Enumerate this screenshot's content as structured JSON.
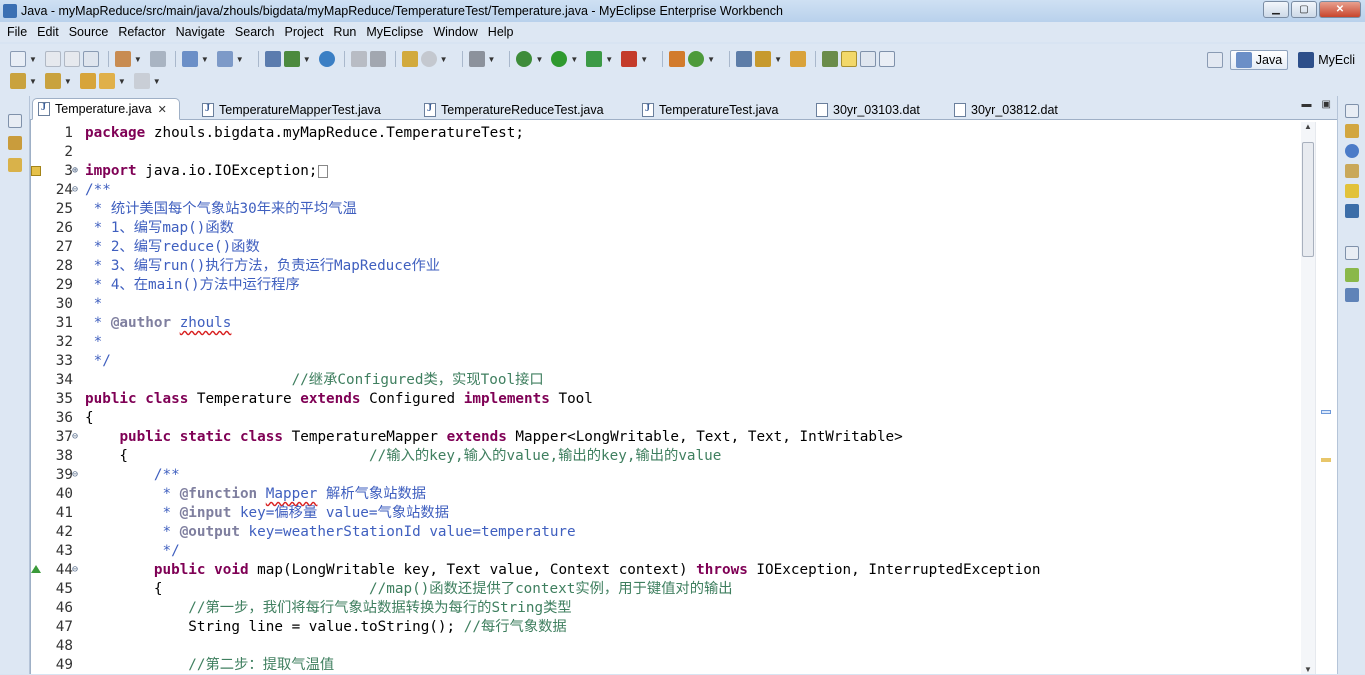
{
  "window": {
    "title": "Java - myMapReduce/src/main/java/zhouls/bigdata/myMapReduce/TemperatureTest/Temperature.java - MyEclipse Enterprise Workbench",
    "minimize": "▁",
    "maximize": "▢",
    "close": "✕"
  },
  "menu": [
    "File",
    "Edit",
    "Source",
    "Refactor",
    "Navigate",
    "Search",
    "Project",
    "Run",
    "MyEclipse",
    "Window",
    "Help"
  ],
  "perspectives": {
    "java": "Java",
    "myeclipse": "MyEcli"
  },
  "tabs": [
    {
      "label": "Temperature.java",
      "active": true,
      "type": "java"
    },
    {
      "label": "TemperatureMapperTest.java",
      "active": false,
      "type": "java"
    },
    {
      "label": "TemperatureReduceTest.java",
      "active": false,
      "type": "java"
    },
    {
      "label": "TemperatureTest.java",
      "active": false,
      "type": "java"
    },
    {
      "label": "30yr_03103.dat",
      "active": false,
      "type": "file"
    },
    {
      "label": "30yr_03812.dat",
      "active": false,
      "type": "file"
    }
  ],
  "tab_close": "✕",
  "colors": {
    "keyword": "#7f0055",
    "javadoc": "#3f5fbf",
    "line_comment": "#3f7f5f",
    "javadoc_tag": "#7f7f9f"
  },
  "code_lines": [
    {
      "n": "1",
      "fold": "",
      "parts": [
        {
          "t": "package",
          "c": "kw"
        },
        {
          "t": " zhouls.bigdata.myMapReduce.TemperatureTest;",
          "c": ""
        }
      ]
    },
    {
      "n": "2",
      "fold": "",
      "parts": []
    },
    {
      "n": "3",
      "fold": "⊕",
      "mark": "warn",
      "parts": [
        {
          "t": "import",
          "c": "kw"
        },
        {
          "t": " java.io.IOException;",
          "c": ""
        },
        {
          "t": "",
          "c": "fbox"
        }
      ]
    },
    {
      "n": "24",
      "fold": "⊖",
      "parts": [
        {
          "t": "/**",
          "c": "cm"
        }
      ]
    },
    {
      "n": "25",
      "fold": "",
      "parts": [
        {
          "t": " * 统计美国每个气象站30年来的平均气温",
          "c": "cm"
        }
      ]
    },
    {
      "n": "26",
      "fold": "",
      "parts": [
        {
          "t": " * 1、编写map()函数",
          "c": "cm"
        }
      ]
    },
    {
      "n": "27",
      "fold": "",
      "parts": [
        {
          "t": " * 2、编写reduce()函数",
          "c": "cm"
        }
      ]
    },
    {
      "n": "28",
      "fold": "",
      "parts": [
        {
          "t": " * 3、编写run()执行方法，负责运行MapReduce作业",
          "c": "cm"
        }
      ]
    },
    {
      "n": "29",
      "fold": "",
      "parts": [
        {
          "t": " * 4、在main()方法中运行程序",
          "c": "cm"
        }
      ]
    },
    {
      "n": "30",
      "fold": "",
      "parts": [
        {
          "t": " *",
          "c": "cm"
        }
      ]
    },
    {
      "n": "31",
      "fold": "",
      "parts": [
        {
          "t": " * ",
          "c": "cm"
        },
        {
          "t": "@author",
          "c": "tg"
        },
        {
          "t": " ",
          "c": "cm"
        },
        {
          "t": "zhouls",
          "c": "cm sq"
        }
      ]
    },
    {
      "n": "32",
      "fold": "",
      "parts": [
        {
          "t": " *",
          "c": "cm"
        }
      ]
    },
    {
      "n": "33",
      "fold": "",
      "parts": [
        {
          "t": " */",
          "c": "cm"
        }
      ]
    },
    {
      "n": "34",
      "fold": "",
      "parts": [
        {
          "t": "                        //继承Configured类，实现Tool接口",
          "c": "lc"
        }
      ]
    },
    {
      "n": "35",
      "fold": "",
      "parts": [
        {
          "t": "public",
          "c": "kw"
        },
        {
          "t": " ",
          "c": ""
        },
        {
          "t": "class",
          "c": "kw"
        },
        {
          "t": " Temperature ",
          "c": ""
        },
        {
          "t": "extends",
          "c": "kw"
        },
        {
          "t": " Configured ",
          "c": ""
        },
        {
          "t": "implements",
          "c": "kw"
        },
        {
          "t": " Tool",
          "c": ""
        }
      ]
    },
    {
      "n": "36",
      "fold": "",
      "parts": [
        {
          "t": "{",
          "c": ""
        }
      ]
    },
    {
      "n": "37",
      "fold": "⊖",
      "parts": [
        {
          "t": "    ",
          "c": ""
        },
        {
          "t": "public",
          "c": "kw"
        },
        {
          "t": " ",
          "c": ""
        },
        {
          "t": "static",
          "c": "kw"
        },
        {
          "t": " ",
          "c": ""
        },
        {
          "t": "class",
          "c": "kw"
        },
        {
          "t": " TemperatureMapper ",
          "c": ""
        },
        {
          "t": "extends",
          "c": "kw"
        },
        {
          "t": " Mapper<LongWritable, Text, Text, IntWritable>",
          "c": ""
        }
      ]
    },
    {
      "n": "38",
      "fold": "",
      "parts": [
        {
          "t": "    {                            ",
          "c": ""
        },
        {
          "t": "//输入的key,输入的value,输出的key,输出的value",
          "c": "lc"
        }
      ]
    },
    {
      "n": "39",
      "fold": "⊖",
      "parts": [
        {
          "t": "        /**",
          "c": "cm"
        }
      ]
    },
    {
      "n": "40",
      "fold": "",
      "parts": [
        {
          "t": "         * ",
          "c": "cm"
        },
        {
          "t": "@function",
          "c": "tg"
        },
        {
          "t": " ",
          "c": "cm"
        },
        {
          "t": "Mapper",
          "c": "cm sq"
        },
        {
          "t": " 解析气象站数据",
          "c": "cm"
        }
      ]
    },
    {
      "n": "41",
      "fold": "",
      "parts": [
        {
          "t": "         * ",
          "c": "cm"
        },
        {
          "t": "@input",
          "c": "tg"
        },
        {
          "t": " key=偏移量 value=气象站数据",
          "c": "cm"
        }
      ]
    },
    {
      "n": "42",
      "fold": "",
      "parts": [
        {
          "t": "         * ",
          "c": "cm"
        },
        {
          "t": "@output",
          "c": "tg"
        },
        {
          "t": " key=weatherStationId value=temperature",
          "c": "cm"
        }
      ]
    },
    {
      "n": "43",
      "fold": "",
      "parts": [
        {
          "t": "         */",
          "c": "cm"
        }
      ]
    },
    {
      "n": "44",
      "fold": "⊖",
      "mark": "override",
      "parts": [
        {
          "t": "        ",
          "c": ""
        },
        {
          "t": "public",
          "c": "kw"
        },
        {
          "t": " ",
          "c": ""
        },
        {
          "t": "void",
          "c": "kw"
        },
        {
          "t": " map(LongWritable key, Text value, Context context) ",
          "c": ""
        },
        {
          "t": "throws",
          "c": "kw"
        },
        {
          "t": " IOException, InterruptedException",
          "c": ""
        }
      ]
    },
    {
      "n": "45",
      "fold": "",
      "parts": [
        {
          "t": "        {                        ",
          "c": ""
        },
        {
          "t": "//map()函数还提供了context实例，用于键值对的输出",
          "c": "lc"
        }
      ]
    },
    {
      "n": "46",
      "fold": "",
      "parts": [
        {
          "t": "            ",
          "c": ""
        },
        {
          "t": "//第一步，我们将每行气象站数据转换为每行的String类型",
          "c": "lc"
        }
      ]
    },
    {
      "n": "47",
      "fold": "",
      "parts": [
        {
          "t": "            String line = value.toString(); ",
          "c": ""
        },
        {
          "t": "//每行气象数据",
          "c": "lc"
        }
      ]
    },
    {
      "n": "48",
      "fold": "",
      "parts": []
    },
    {
      "n": "49",
      "fold": "",
      "parts": [
        {
          "t": "            ",
          "c": ""
        },
        {
          "t": "//第二步：提取气温值",
          "c": "lc"
        }
      ]
    }
  ]
}
